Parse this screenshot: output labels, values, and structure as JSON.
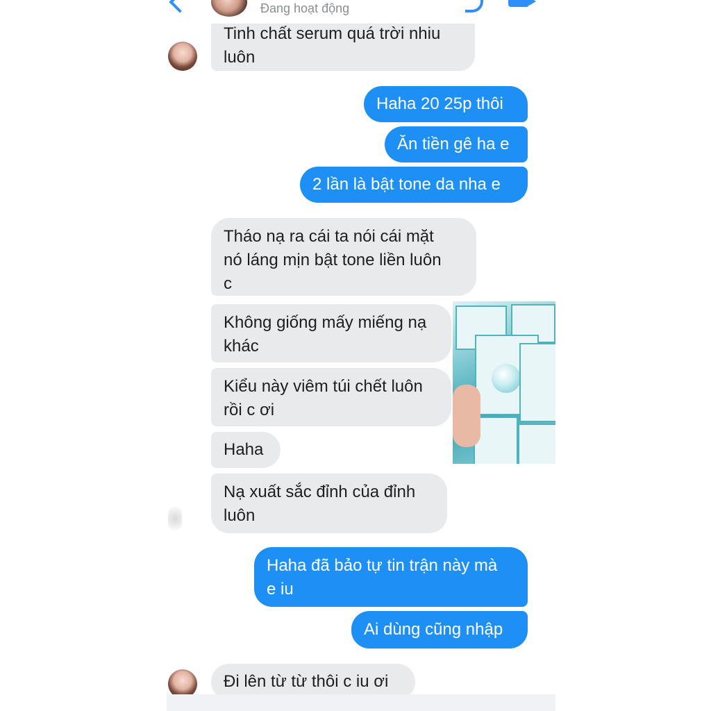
{
  "header": {
    "status": "Đang hoạt động"
  },
  "messages": [
    {
      "side": "in",
      "lines": [
        "Tinh chất serum quá trời nhiu",
        "luôn"
      ]
    },
    {
      "side": "out",
      "lines": [
        "Haha 20 25p thôi"
      ]
    },
    {
      "side": "out",
      "lines": [
        "Ăn tiền gê ha e"
      ]
    },
    {
      "side": "out",
      "lines": [
        "2 lần là bật tone da nha e"
      ]
    },
    {
      "side": "in",
      "lines": [
        "Tháo nạ ra cái ta nói cái mặt",
        "nó láng mịn bật tone liền luôn",
        "c"
      ]
    },
    {
      "side": "in",
      "lines": [
        "Không giống mấy miếng nạ",
        "khác"
      ]
    },
    {
      "side": "in",
      "lines": [
        "Kiểu này viêm túi chết luôn",
        "rồi c ơi"
      ]
    },
    {
      "side": "in",
      "lines": [
        "Haha"
      ]
    },
    {
      "side": "in",
      "lines": [
        "Nạ xuất sắc đỉnh của đỉnh",
        "luôn"
      ]
    },
    {
      "side": "out",
      "lines": [
        "Haha đã bảo tự tin trận này mà",
        "e iu"
      ]
    },
    {
      "side": "out",
      "lines": [
        "Ai dùng cũng nhập"
      ]
    },
    {
      "side": "in",
      "lines": [
        "Đi lên từ từ thôi c iu ơi"
      ]
    }
  ],
  "colors": {
    "outgoing": "#1e8ff5",
    "incoming": "#e9eaec",
    "accent": "#2f8ef7"
  },
  "icons": [
    "back-icon",
    "call-icon",
    "video-icon"
  ]
}
